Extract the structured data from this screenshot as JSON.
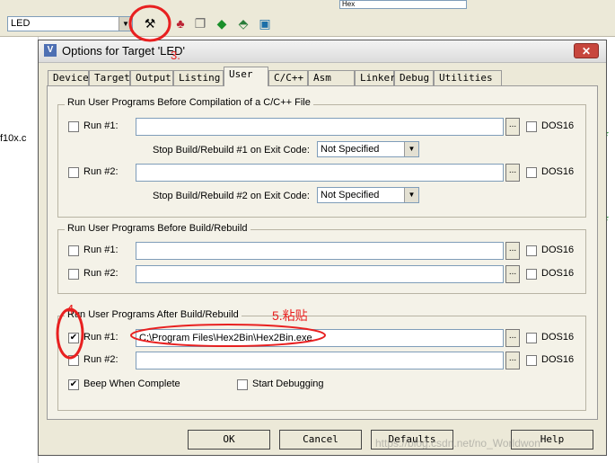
{
  "toolbar": {
    "target_name": "LED",
    "right_combo_value": "Hex"
  },
  "background": {
    "file_fragment": "f10x.c"
  },
  "dialog": {
    "title": "Options for Target 'LED'",
    "close_glyph": "✕",
    "tabs": [
      {
        "label": "Device"
      },
      {
        "label": "Target"
      },
      {
        "label": "Output"
      },
      {
        "label": "Listing"
      },
      {
        "label": "User"
      },
      {
        "label": "C/C++"
      },
      {
        "label": "Asm"
      },
      {
        "label": "Linker"
      },
      {
        "label": "Debug"
      },
      {
        "label": "Utilities"
      }
    ],
    "active_tab": "User",
    "group1": {
      "title": "Run User Programs Before Compilation of a C/C++ File",
      "run1_label": "Run #1:",
      "run1_value": "",
      "run1_checked": false,
      "run1_dos16": "DOS16",
      "stop1_label": "Stop Build/Rebuild #1 on Exit Code:",
      "stop1_value": "Not Specified",
      "run2_label": "Run #2:",
      "run2_value": "",
      "run2_checked": false,
      "run2_dos16": "DOS16",
      "stop2_label": "Stop Build/Rebuild #2 on Exit Code:",
      "stop2_value": "Not Specified"
    },
    "group2": {
      "title": "Run User Programs Before Build/Rebuild",
      "run1_label": "Run #1:",
      "run1_value": "",
      "run1_dos16": "DOS16",
      "run2_label": "Run #2:",
      "run2_value": "",
      "run2_dos16": "DOS16"
    },
    "group3": {
      "title": "Run User Programs After Build/Rebuild",
      "run1_label": "Run #1:",
      "run1_value": "C:\\Program Files\\Hex2Bin\\Hex2Bin.exe",
      "run1_checked": true,
      "run1_dos16": "DOS16",
      "run2_label": "Run #2:",
      "run2_value": "",
      "run2_dos16": "DOS16",
      "beep_label": "Beep When Complete",
      "beep_checked": true,
      "debug_label": "Start Debugging",
      "debug_checked": false
    },
    "browse_label": "...",
    "buttons": {
      "ok": "OK",
      "cancel": "Cancel",
      "defaults": "Defaults",
      "help": "Help"
    }
  },
  "annotations": {
    "step3": "3.",
    "step4": "4",
    "step5": "5.粘贴"
  },
  "watermark": "https://blog.csdn.net/no_Worldwon",
  "colors": {
    "annotation": "#e82020",
    "dialog_bg": "#ece9d8",
    "close_button": "#c7463d"
  }
}
